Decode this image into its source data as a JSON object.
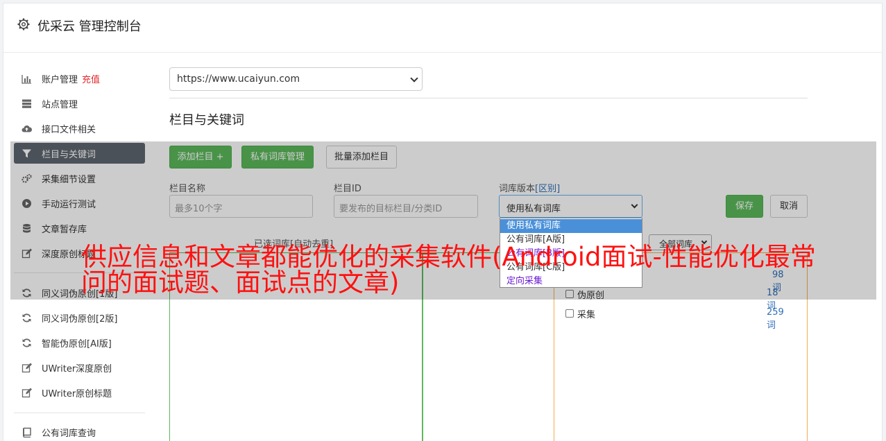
{
  "header": {
    "title": "优采云 管理控制台"
  },
  "sidebar": {
    "items": [
      {
        "label": "账户管理",
        "extra": "充值",
        "icon": "bar-chart-icon"
      },
      {
        "label": "站点管理",
        "icon": "server-icon"
      },
      {
        "label": "接口文件相关",
        "icon": "cloud-upload-icon"
      },
      {
        "label": "栏目与关键词",
        "icon": "filter-icon",
        "active": true
      },
      {
        "label": "采集细节设置",
        "icon": "gears-icon"
      },
      {
        "label": "手动运行测试",
        "icon": "play-circle-icon"
      },
      {
        "label": "文章暂存库",
        "icon": "database-icon"
      },
      {
        "label": "深度原创标题",
        "icon": "edit-icon"
      },
      {
        "label": "同义词伪原创[1版]",
        "icon": "refresh-icon"
      },
      {
        "label": "同义词伪原创[2版]",
        "icon": "refresh-icon"
      },
      {
        "label": "智能伪原创[AI版]",
        "icon": "refresh-icon"
      },
      {
        "label": "UWriter深度原创",
        "icon": "edit-icon"
      },
      {
        "label": "UWriter原创标题",
        "icon": "edit-icon"
      },
      {
        "label": "公有词库查询",
        "icon": "book-icon"
      }
    ]
  },
  "main": {
    "site_select": "https://www.ucaiyun.com",
    "section_title": "栏目与关键词",
    "buttons": {
      "add_column": "添加栏目 +",
      "private_lib": "私有词库管理",
      "batch_add": "批量添加栏目",
      "save": "保存",
      "cancel": "取消"
    },
    "form": {
      "name_label": "栏目名称",
      "name_placeholder": "最多10个字",
      "id_label": "栏目ID",
      "id_placeholder": "要发布的目标栏目/分类ID",
      "version_label": "词库版本",
      "version_link": "[区别]",
      "version_value": "使用私有词库"
    },
    "version_options": [
      "使用私有词库",
      "公有词库[A版]",
      "公有词库[B版]",
      "公有词库[C版]",
      "定向采集"
    ],
    "selected_words_label": "已选词库[自动去重]",
    "filter_select": "全部词库",
    "word_list": [
      {
        "name": "原创",
        "count": "98词"
      },
      {
        "name": "伪原创",
        "count": "18词"
      },
      {
        "name": "采集",
        "count": "259词"
      }
    ]
  },
  "watermark": "供应信息和文章都能优化的采集软件(Android面试-性能优化最常问的面试题、面试点的文章)",
  "colors": {
    "green": "#5cb85c",
    "active_nav": "#5e6670",
    "red_text": "#ff1111",
    "link_blue": "#2f6fb7"
  }
}
